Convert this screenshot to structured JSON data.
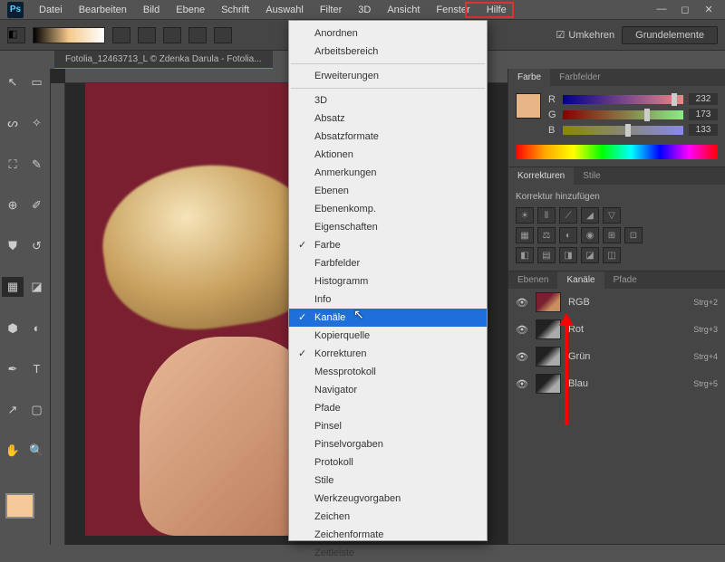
{
  "app_icon": "Ps",
  "menubar": [
    "Datei",
    "Bearbeiten",
    "Bild",
    "Ebene",
    "Schrift",
    "Auswahl",
    "Filter",
    "3D",
    "Ansicht",
    "Fenster",
    "Hilfe"
  ],
  "open_menu_index": 9,
  "doc_tab": "Fotolia_12463713_L © Zdenka Darula - Fotolia...",
  "umkehr_label": "Umkehren",
  "grundelemente": "Grundelemente",
  "dropdown": [
    {
      "type": "item",
      "label": "Anordnen"
    },
    {
      "type": "item",
      "label": "Arbeitsbereich"
    },
    {
      "type": "sep"
    },
    {
      "type": "item",
      "label": "Erweiterungen"
    },
    {
      "type": "sep"
    },
    {
      "type": "item",
      "label": "3D"
    },
    {
      "type": "item",
      "label": "Absatz"
    },
    {
      "type": "item",
      "label": "Absatzformate"
    },
    {
      "type": "item",
      "label": "Aktionen"
    },
    {
      "type": "item",
      "label": "Anmerkungen"
    },
    {
      "type": "item",
      "label": "Ebenen"
    },
    {
      "type": "item",
      "label": "Ebenenkomp."
    },
    {
      "type": "item",
      "label": "Eigenschaften"
    },
    {
      "type": "item",
      "label": "Farbe",
      "checked": true
    },
    {
      "type": "item",
      "label": "Farbfelder"
    },
    {
      "type": "item",
      "label": "Histogramm"
    },
    {
      "type": "item",
      "label": "Info"
    },
    {
      "type": "item",
      "label": "Kanäle",
      "checked": true,
      "highlighted": true
    },
    {
      "type": "item",
      "label": "Kopierquelle"
    },
    {
      "type": "item",
      "label": "Korrekturen",
      "checked": true
    },
    {
      "type": "item",
      "label": "Messprotokoll"
    },
    {
      "type": "item",
      "label": "Navigator"
    },
    {
      "type": "item",
      "label": "Pfade"
    },
    {
      "type": "item",
      "label": "Pinsel"
    },
    {
      "type": "item",
      "label": "Pinselvorgaben"
    },
    {
      "type": "item",
      "label": "Protokoll"
    },
    {
      "type": "item",
      "label": "Stile"
    },
    {
      "type": "item",
      "label": "Werkzeugvorgaben"
    },
    {
      "type": "item",
      "label": "Zeichen"
    },
    {
      "type": "item",
      "label": "Zeichenformate"
    },
    {
      "type": "item",
      "label": "Zeitleiste"
    }
  ],
  "panels": {
    "color": {
      "tabs": [
        "Farbe",
        "Farbfelder"
      ],
      "active": 0,
      "channels": [
        {
          "label": "R",
          "value": "232",
          "pos": 90
        },
        {
          "label": "G",
          "value": "173",
          "pos": 68
        },
        {
          "label": "B",
          "value": "133",
          "pos": 52
        }
      ]
    },
    "adjustments": {
      "tabs": [
        "Korrekturen",
        "Stile"
      ],
      "active": 0,
      "title": "Korrektur hinzufügen"
    },
    "channels_panel": {
      "tabs": [
        "Ebenen",
        "Kanäle",
        "Pfade"
      ],
      "active": 1,
      "rows": [
        {
          "name": "RGB",
          "shortcut": "Strg+2",
          "rgb": true
        },
        {
          "name": "Rot",
          "shortcut": "Strg+3"
        },
        {
          "name": "Grün",
          "shortcut": "Strg+4"
        },
        {
          "name": "Blau",
          "shortcut": "Strg+5"
        }
      ]
    }
  }
}
